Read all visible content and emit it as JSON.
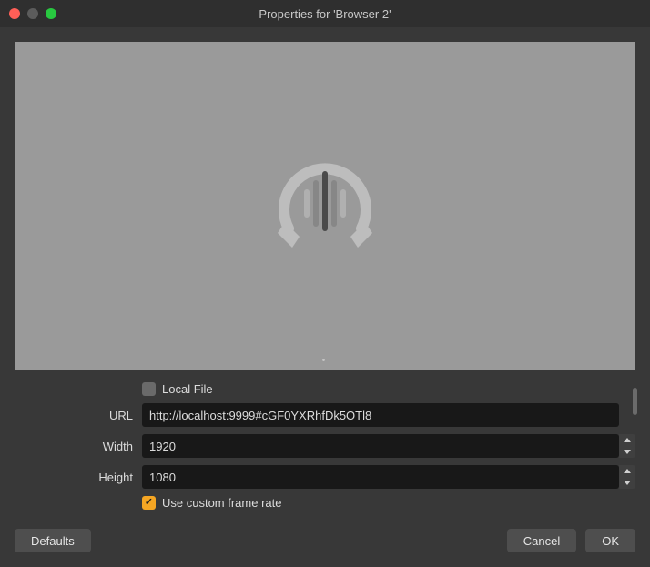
{
  "window": {
    "title": "Properties for 'Browser 2'"
  },
  "form": {
    "local_file": {
      "label": "Local File",
      "checked": false
    },
    "url": {
      "label": "URL",
      "value": "http://localhost:9999#cGF0YXRhfDk5OTl8"
    },
    "width": {
      "label": "Width",
      "value": "1920"
    },
    "height": {
      "label": "Height",
      "value": "1080"
    },
    "custom_frame_rate": {
      "label": "Use custom frame rate",
      "checked": true
    }
  },
  "buttons": {
    "defaults": "Defaults",
    "cancel": "Cancel",
    "ok": "OK"
  }
}
